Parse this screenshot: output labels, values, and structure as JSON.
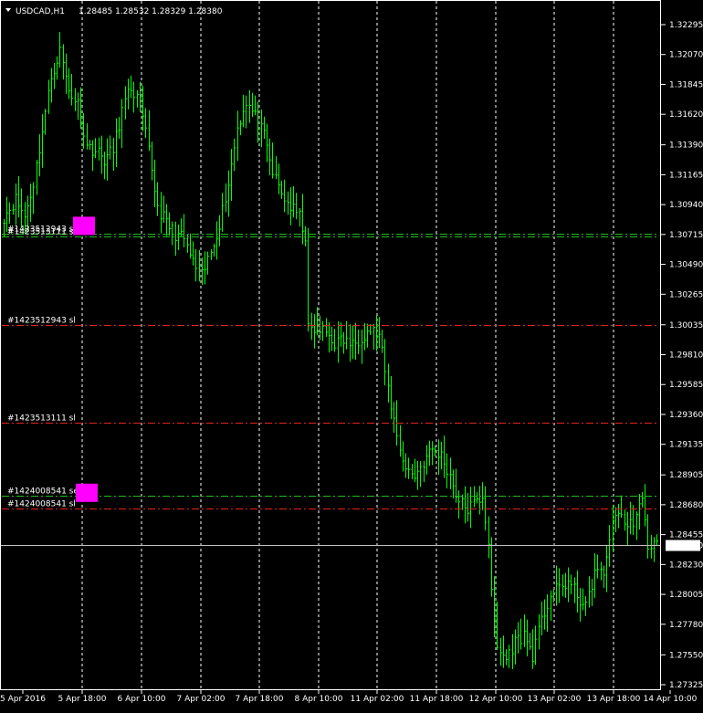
{
  "header": {
    "symbol": "USDCAD,H1",
    "ohlc": "1.28485 1.28532 1.28329 1.28380"
  },
  "colors": {
    "background": "#000000",
    "candle": "#00ff00",
    "frame": "#ffffff",
    "sell_line": "#1dbd1d",
    "sl_line": "#e0241b",
    "marker": "#ff00ff",
    "current_price_line": "#c0c0c0"
  },
  "chart_data": {
    "type": "ohlc",
    "timeframe": "H1",
    "ylim": [
      1.27325,
      1.32295
    ],
    "y_ticks": [
      "1.32295",
      "1.32070",
      "1.31845",
      "1.31620",
      "1.31390",
      "1.31165",
      "1.30940",
      "1.30715",
      "1.30490",
      "1.30265",
      "1.30035",
      "1.29810",
      "1.29585",
      "1.29360",
      "1.29135",
      "1.28905",
      "1.28680",
      "1.28455",
      "1.28230",
      "1.28005",
      "1.27780",
      "1.27550",
      "1.27325"
    ],
    "x_ticks": [
      "5 Apr 2016",
      "5 Apr 18:00",
      "6 Apr 10:00",
      "7 Apr 02:00",
      "7 Apr 18:00",
      "8 Apr 10:00",
      "11 Apr 02:00",
      "11 Apr 18:00",
      "12 Apr 10:00",
      "13 Apr 02:00",
      "13 Apr 18:00",
      "14 Apr 10:00"
    ],
    "current_price": 1.2838,
    "grid": "vertical dotted",
    "close_path": [
      {
        "x": 0,
        "y": 1.3085
      },
      {
        "x": 4,
        "y": 1.3098
      },
      {
        "x": 7,
        "y": 1.3085
      },
      {
        "x": 10,
        "y": 1.311
      },
      {
        "x": 13,
        "y": 1.315
      },
      {
        "x": 16,
        "y": 1.319
      },
      {
        "x": 19,
        "y": 1.321
      },
      {
        "x": 22,
        "y": 1.318
      },
      {
        "x": 25,
        "y": 1.317
      },
      {
        "x": 28,
        "y": 1.3138
      },
      {
        "x": 31,
        "y": 1.3135
      },
      {
        "x": 34,
        "y": 1.3128
      },
      {
        "x": 37,
        "y": 1.3135
      },
      {
        "x": 40,
        "y": 1.3165
      },
      {
        "x": 43,
        "y": 1.3182
      },
      {
        "x": 46,
        "y": 1.317
      },
      {
        "x": 49,
        "y": 1.3135
      },
      {
        "x": 52,
        "y": 1.3092
      },
      {
        "x": 55,
        "y": 1.308
      },
      {
        "x": 58,
        "y": 1.3072
      },
      {
        "x": 61,
        "y": 1.3068
      },
      {
        "x": 64,
        "y": 1.305
      },
      {
        "x": 67,
        "y": 1.304
      },
      {
        "x": 70,
        "y": 1.3058
      },
      {
        "x": 73,
        "y": 1.308
      },
      {
        "x": 76,
        "y": 1.311
      },
      {
        "x": 79,
        "y": 1.3152
      },
      {
        "x": 82,
        "y": 1.3172
      },
      {
        "x": 85,
        "y": 1.316
      },
      {
        "x": 88,
        "y": 1.3145
      },
      {
        "x": 91,
        "y": 1.3118
      },
      {
        "x": 94,
        "y": 1.3102
      },
      {
        "x": 97,
        "y": 1.3092
      },
      {
        "x": 100,
        "y": 1.3085
      },
      {
        "x": 102,
        "y": 1.307
      },
      {
        "x": 103,
        "y": 1.3
      },
      {
        "x": 106,
        "y": 1.3
      },
      {
        "x": 109,
        "y": 1.2998
      },
      {
        "x": 112,
        "y": 1.299
      },
      {
        "x": 115,
        "y": 1.2992
      },
      {
        "x": 118,
        "y": 1.2988
      },
      {
        "x": 121,
        "y": 1.2995
      },
      {
        "x": 124,
        "y": 1.3
      },
      {
        "x": 127,
        "y": 1.2995
      },
      {
        "x": 130,
        "y": 1.2955
      },
      {
        "x": 133,
        "y": 1.292
      },
      {
        "x": 136,
        "y": 1.2895
      },
      {
        "x": 139,
        "y": 1.289
      },
      {
        "x": 142,
        "y": 1.29
      },
      {
        "x": 145,
        "y": 1.291
      },
      {
        "x": 148,
        "y": 1.2905
      },
      {
        "x": 151,
        "y": 1.289
      },
      {
        "x": 154,
        "y": 1.287
      },
      {
        "x": 157,
        "y": 1.2865
      },
      {
        "x": 160,
        "y": 1.287
      },
      {
        "x": 162,
        "y": 1.2875
      },
      {
        "x": 164,
        "y": 1.284
      },
      {
        "x": 165,
        "y": 1.28
      },
      {
        "x": 167,
        "y": 1.276
      },
      {
        "x": 170,
        "y": 1.2752
      },
      {
        "x": 173,
        "y": 1.2765
      },
      {
        "x": 176,
        "y": 1.277
      },
      {
        "x": 179,
        "y": 1.2755
      },
      {
        "x": 182,
        "y": 1.278
      },
      {
        "x": 185,
        "y": 1.28
      },
      {
        "x": 188,
        "y": 1.2805
      },
      {
        "x": 191,
        "y": 1.281
      },
      {
        "x": 194,
        "y": 1.28
      },
      {
        "x": 197,
        "y": 1.279
      },
      {
        "x": 200,
        "y": 1.2818
      },
      {
        "x": 203,
        "y": 1.2815
      },
      {
        "x": 205,
        "y": 1.2845
      },
      {
        "x": 208,
        "y": 1.2865
      },
      {
        "x": 211,
        "y": 1.285
      },
      {
        "x": 214,
        "y": 1.286
      },
      {
        "x": 216,
        "y": 1.287
      },
      {
        "x": 218,
        "y": 1.2838
      }
    ],
    "trade_lines": [
      {
        "label": "#1423512943 sell",
        "price": 1.30718,
        "kind": "sell"
      },
      {
        "label": "#1423513111 sell",
        "price": 1.307,
        "kind": "sell"
      },
      {
        "label": "#1423512943 sl",
        "price": 1.30035,
        "kind": "sl"
      },
      {
        "label": "#1423513111 sl",
        "price": 1.29295,
        "kind": "sl"
      },
      {
        "label": "#1424008541 sell",
        "price": 1.2875,
        "kind": "sell"
      },
      {
        "label": "#1424008541 sl",
        "price": 1.28655,
        "kind": "sl"
      }
    ]
  }
}
